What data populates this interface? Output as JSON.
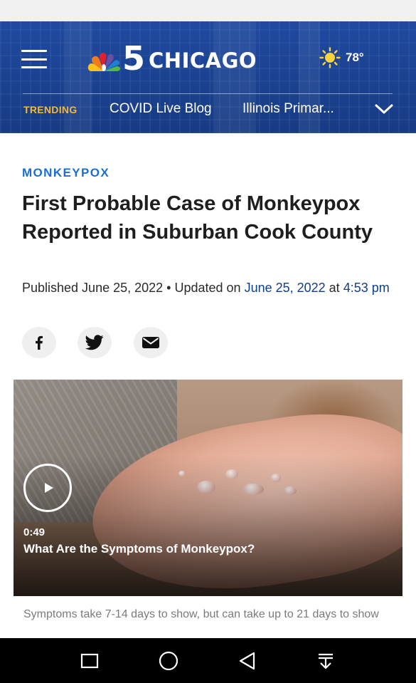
{
  "header": {
    "logo_number": "5",
    "logo_city": "CHICAGO",
    "temperature": "78°",
    "trending_label": "TRENDING",
    "trending_links": [
      "COVID Live Blog",
      "Illinois Primar..."
    ]
  },
  "article": {
    "category": "MONKEYPOX",
    "headline": "First Probable Case of Monkeypox Reported in Suburban Cook County",
    "published_prefix": "Published June 25, 2022",
    "bullet": " • ",
    "updated_prefix": "Updated on ",
    "updated_date": "June 25, 2022",
    "at_word": " at ",
    "updated_time": "4:53 pm",
    "share_icons": [
      "facebook-icon",
      "twitter-icon",
      "email-icon"
    ]
  },
  "video": {
    "duration": "0:49",
    "title": "What Are the Symptoms of Monkeypox?",
    "caption": "Symptoms take 7-14 days to show, but can take up to 21 days to show"
  },
  "colors": {
    "header_blue": "#1d449a",
    "trending_gold": "#f5b83a",
    "kicker_blue": "#1a6fd1",
    "date_link_blue": "#0f3f8c"
  }
}
